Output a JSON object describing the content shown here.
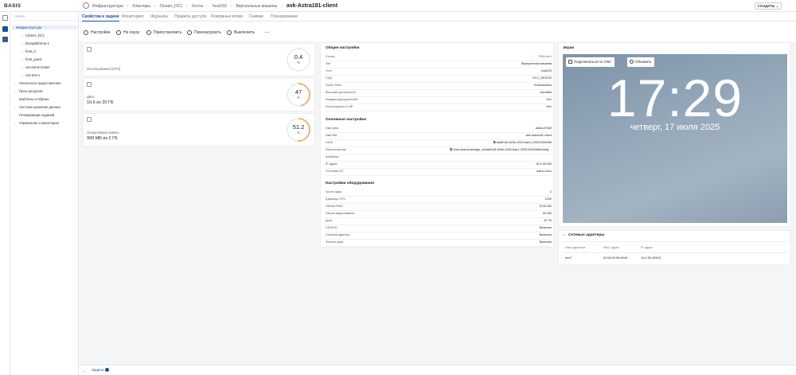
{
  "app": {
    "logo": "BASIS",
    "create_label": "СОЗДАТЬ"
  },
  "breadcrumb": {
    "items": [
      "Инфраструктура",
      "Кластеры",
      "Cluster_DC1",
      "Хосты",
      "host153",
      "Виртуальные машины"
    ],
    "current": "avk-Astra181-client"
  },
  "sidebar": {
    "search_placeholder": "Найти",
    "items": [
      {
        "label": "Инфраструктура",
        "chev": "⌄"
      },
      {
        "label": "Cluster_DC1",
        "chev": "›"
      },
      {
        "label": "Bootplatforma-1",
        "chev": "›"
      },
      {
        "label": "host_cl",
        "chev": "›"
      },
      {
        "label": "host_guest",
        "chev": "›"
      },
      {
        "label": "ovcontrol-cluster",
        "chev": "›"
      },
      {
        "label": "ovs-test-1",
        "chev": "›"
      },
      {
        "label": "Логическое представление",
        "chev": "›"
      },
      {
        "label": "Пулы ресурсов",
        "chev": "›"
      },
      {
        "label": "Шаблоны и образы",
        "chev": ""
      },
      {
        "label": "Система хранения данных",
        "chev": "›"
      },
      {
        "label": "Планировщик заданий",
        "chev": ""
      },
      {
        "label": "Управление и мониторинг",
        "chev": "›"
      }
    ]
  },
  "tabs": [
    "Свойства и задачи",
    "Мониторинг",
    "Журналы",
    "Правила доступа",
    "Резервные копии",
    "Снимки",
    "Планирование"
  ],
  "actions": [
    "Настройки",
    "На паузу",
    "Приостановить",
    "Перезагрузить",
    "Выключить"
  ],
  "metrics": [
    {
      "label": "Использование [CPU]",
      "value": "",
      "gauge_value": "0.4",
      "gauge_unit": "%",
      "fraction": 0.004
    },
    {
      "label": "Диск:",
      "value": "10.6 из 20 ГБ",
      "gauge_value": "47",
      "gauge_unit": "%",
      "fraction": 0.47
    },
    {
      "label": "Оперативная память",
      "value": "999 МБ из 2 ГБ",
      "gauge_value": "51.2",
      "gauge_unit": "%",
      "fraction": 0.512
    }
  ],
  "general": {
    "title": "Общие настройки",
    "rows": [
      {
        "k": "Статус",
        "v": "Работает"
      },
      {
        "k": "Тип",
        "v": "Виртуальная машина"
      },
      {
        "k": "Хост",
        "v": "host153"
      },
      {
        "k": "СХД",
        "v": "DC1_NFS102"
      },
      {
        "k": "Guest Tools",
        "v": "Установлено"
      },
      {
        "k": "Высокая доступность",
        "v": "Активна"
      },
      {
        "k": "Инфраструктурная ВМ",
        "v": "Нет"
      },
      {
        "k": "Используется в VIP",
        "v": "Нет"
      }
    ]
  },
  "basic": {
    "title": "Основные настройки",
    "rows": [
      {
        "k": "Имя узла",
        "v": "astra-87560"
      },
      {
        "k": "Имя ВМ",
        "v": "avk-Astra181-client"
      },
      {
        "k": "UUID",
        "v": "afa6f145-829e-4320-bae1-2292125920bf"
      },
      {
        "k": "Расположение",
        "v": "/vms-shares/storage_4/afa6f145-829e-4320-bae1-2292125920bf/config…"
      },
      {
        "k": "Шаблоны",
        "v": ""
      },
      {
        "k": "IP адрес",
        "v": "10.0.38.209"
      },
      {
        "k": "Гостевая ОС",
        "v": "Astra Linux"
      }
    ]
  },
  "hardware": {
    "title": "Настройки оборудования",
    "rows": [
      {
        "k": "Число ядер",
        "v": "2"
      },
      {
        "k": "Единицы CPU",
        "v": "1000"
      },
      {
        "k": "Объем RAM",
        "v": "5744 МБ"
      },
      {
        "k": "Объем видеопамяти",
        "v": "64 МБ"
      },
      {
        "k": "Диск",
        "v": "20 ГБ"
      },
      {
        "k": "CD/DVD",
        "v": "Включен"
      },
      {
        "k": "Сетевой адаптер",
        "v": "Включен"
      },
      {
        "k": "Флоппи диск",
        "v": "Включен"
      }
    ]
  },
  "screen": {
    "title": "Экран",
    "vnc_label": "Подключиться по VNC",
    "refresh_label": "Обновить",
    "clock": "17:29",
    "date": "четверг, 17 июля 2025"
  },
  "network": {
    "title": "Сетевые адаптеры",
    "headers": [
      "Имя адаптера",
      "MAC-адрес",
      "IP-адрес"
    ],
    "rows": [
      {
        "name": "ens7",
        "mac": "52:54:00:00:c8:a3",
        "ip": "10.0.38.209/24"
      }
    ]
  },
  "bottom": {
    "tasks_label": "Задачи"
  },
  "colors": {
    "accent": "#1a4fa0",
    "gauge": "#f0a050",
    "ok": "#3a9a3a"
  }
}
